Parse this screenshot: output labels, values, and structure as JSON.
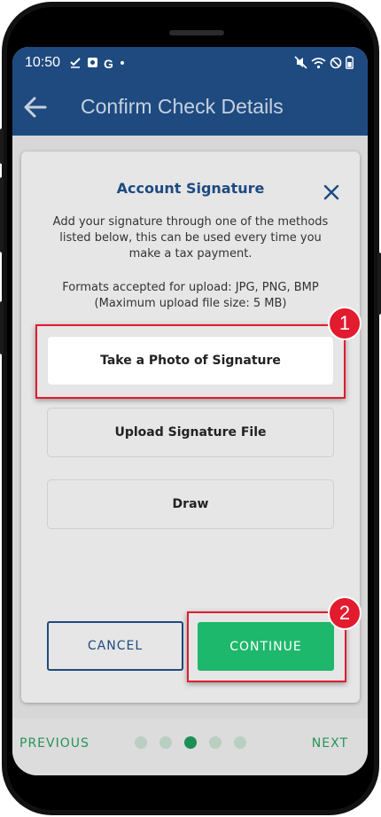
{
  "status_bar": {
    "time": "10:50",
    "left_icons": [
      "check-icon",
      "app-icon",
      "google-icon",
      "dot-icon"
    ],
    "right_icons": [
      "mute-icon",
      "wifi-icon",
      "no-sign-icon",
      "battery-icon"
    ]
  },
  "app_bar": {
    "title": "Confirm Check Details",
    "back_icon": "arrow-left-icon"
  },
  "dialog": {
    "title": "Account Signature",
    "description": "Add your signature through one of the methods listed below, this can be used every time you make a tax payment.",
    "formats_line1": "Formats accepted for upload: JPG, PNG, BMP",
    "formats_line2": "(Maximum upload file size: 5 MB)",
    "methods": [
      {
        "label": "Take a Photo of Signature",
        "selected": true
      },
      {
        "label": "Upload Signature File",
        "selected": false
      },
      {
        "label": "Draw",
        "selected": false
      }
    ],
    "cancel_label": "CANCEL",
    "continue_label": "CONTINUE"
  },
  "annotations": [
    {
      "number": "1"
    },
    {
      "number": "2"
    }
  ],
  "footer": {
    "previous_label": "PREVIOUS",
    "next_label": "NEXT",
    "page_count": 5,
    "current_page": 3
  },
  "colors": {
    "brand_blue": "#1e4a80",
    "continue_green": "#1db86b",
    "nav_green": "#27935a",
    "annotation_red": "#e21b2e"
  }
}
